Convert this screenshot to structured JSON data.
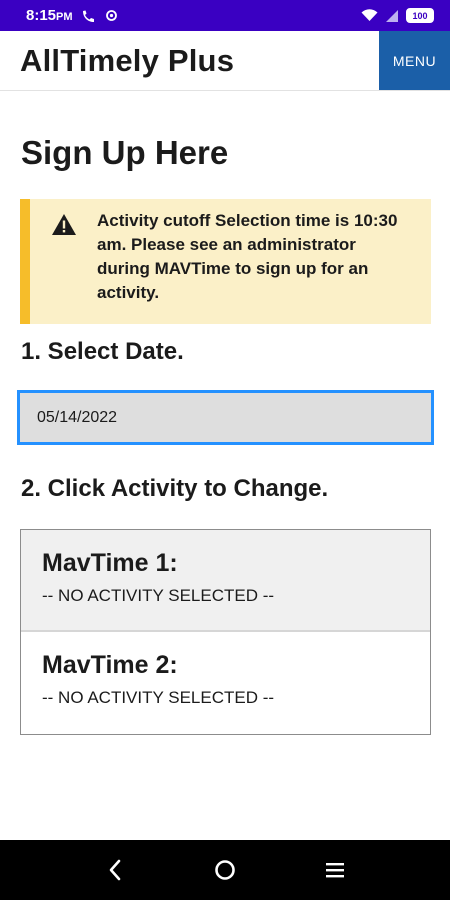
{
  "status_bar": {
    "time": "8:15",
    "ampm": "PM",
    "battery": "100",
    "icons": [
      "phone-wifi-icon",
      "sync-icon",
      "wifi-icon",
      "signal-icon",
      "battery-icon"
    ]
  },
  "header": {
    "title": "AllTimely Plus",
    "menu_label": "MENU"
  },
  "page": {
    "title": "Sign Up Here",
    "alert": {
      "icon": "warning-icon",
      "text": "Activity cutoff Selection time is 10:30 am. Please see an administrator during MAVTime to sign up for an activity."
    },
    "step1_label": "1. Select Date.",
    "date_value": "05/14/2022",
    "step2_label": "2. Click Activity to Change.",
    "activities": [
      {
        "name": "MavTime 1:",
        "value": "-- NO ACTIVITY SELECTED --"
      },
      {
        "name": "MavTime 2:",
        "value": "-- NO ACTIVITY SELECTED --"
      }
    ]
  },
  "nav_bar": {
    "buttons": [
      "back-icon",
      "home-icon",
      "recents-icon"
    ]
  },
  "colors": {
    "status_bar": "#3a00c2",
    "menu_button": "#1b5fa8",
    "alert_bg": "#fbf0c8",
    "alert_border": "#f6bd2a",
    "input_focus": "#2491ff"
  }
}
